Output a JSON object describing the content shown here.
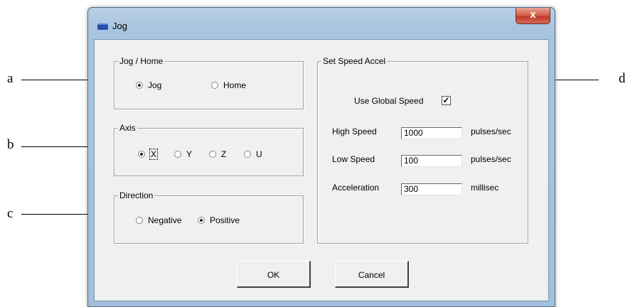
{
  "annotations": {
    "a": "a",
    "b": "b",
    "c": "c",
    "d": "d"
  },
  "window": {
    "title": "Jog",
    "close_label": "x"
  },
  "jog_home": {
    "legend": "Jog / Home",
    "options": [
      {
        "label": "Jog",
        "selected": true
      },
      {
        "label": "Home",
        "selected": false
      }
    ]
  },
  "axis": {
    "legend": "Axis",
    "options": [
      {
        "label": "X",
        "selected": true
      },
      {
        "label": "Y",
        "selected": false
      },
      {
        "label": "Z",
        "selected": false
      },
      {
        "label": "U",
        "selected": false
      }
    ]
  },
  "direction": {
    "legend": "Direction",
    "options": [
      {
        "label": "Negative",
        "selected": false
      },
      {
        "label": "Positive",
        "selected": true
      }
    ]
  },
  "speed": {
    "legend": "Set Speed Accel",
    "global_label": "Use Global Speed",
    "global_checked": true,
    "high_label": "High Speed",
    "high_value": "1000",
    "high_unit": "pulses/sec",
    "low_label": "Low Speed",
    "low_value": "100",
    "low_unit": "pulses/sec",
    "accel_label": "Acceleration",
    "accel_value": "300",
    "accel_unit": "millisec"
  },
  "buttons": {
    "ok": "OK",
    "cancel": "Cancel"
  }
}
